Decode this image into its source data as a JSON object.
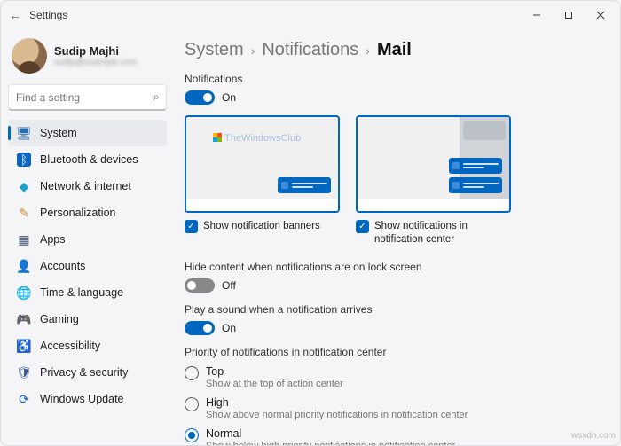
{
  "window": {
    "title": "Settings"
  },
  "user": {
    "name": "Sudip Majhi",
    "email": "sudip@example.com"
  },
  "search": {
    "placeholder": "Find a setting"
  },
  "nav": [
    {
      "label": "System",
      "icon": "🖥",
      "cls": "i-system",
      "active": true
    },
    {
      "label": "Bluetooth & devices",
      "icon": "ᛒ",
      "cls": "i-bt"
    },
    {
      "label": "Network & internet",
      "icon": "◆",
      "cls": "i-net"
    },
    {
      "label": "Personalization",
      "icon": "✎",
      "cls": "i-pers"
    },
    {
      "label": "Apps",
      "icon": "▦",
      "cls": "i-apps"
    },
    {
      "label": "Accounts",
      "icon": "👤",
      "cls": "i-acct"
    },
    {
      "label": "Time & language",
      "icon": "🌐",
      "cls": "i-time"
    },
    {
      "label": "Gaming",
      "icon": "🎮",
      "cls": "i-game"
    },
    {
      "label": "Accessibility",
      "icon": "♿",
      "cls": "i-acc"
    },
    {
      "label": "Privacy & security",
      "icon": "🛡",
      "cls": "i-priv"
    },
    {
      "label": "Windows Update",
      "icon": "⟳",
      "cls": "i-wu"
    }
  ],
  "breadcrumb": {
    "a": "System",
    "b": "Notifications",
    "c": "Mail"
  },
  "sections": {
    "notifications_label": "Notifications",
    "notifications_state": "On",
    "banner_label": "Show notification banners",
    "center_label": "Show notifications in notification center",
    "watermark": "TheWindowsClub",
    "hide_content_label": "Hide content when notifications are on lock screen",
    "hide_content_state": "Off",
    "sound_label": "Play a sound when a notification arrives",
    "sound_state": "On",
    "priority_label": "Priority of notifications in notification center",
    "priority": [
      {
        "label": "Top",
        "desc": "Show at the top of action center",
        "selected": false
      },
      {
        "label": "High",
        "desc": "Show above normal priority notifications in notification center",
        "selected": false
      },
      {
        "label": "Normal",
        "desc": "Show below high priority notifications in notification center",
        "selected": true
      }
    ]
  },
  "footer_watermark": "wsxdn.com"
}
